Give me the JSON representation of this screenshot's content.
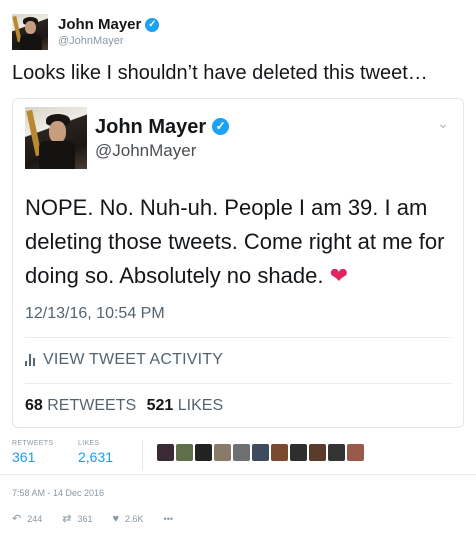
{
  "outer_tweet": {
    "display_name": "John Mayer",
    "handle": "@JohnMayer",
    "text": "Looks like I shouldn’t have deleted this tweet…"
  },
  "quoted_tweet": {
    "display_name": "John Mayer",
    "handle": "@JohnMayer",
    "text": "NOPE. No. Nuh-uh. People I am 39. I am deleting those tweets. Come right at me for doing so. Absolutely no shade.",
    "heart_glyph": "❤",
    "time": "12/13/16, 10:54 PM",
    "activity_label": "VIEW TWEET ACTIVITY",
    "retweets_count": "68",
    "retweets_label": "RETWEETS",
    "likes_count": "521",
    "likes_label": "LIKES"
  },
  "engagement": {
    "retweets_label": "RETWEETS",
    "retweets_value": "361",
    "likes_label": "LIKES",
    "likes_value": "2,631",
    "liker_colors": [
      "#3a2a35",
      "#5e6f4a",
      "#222222",
      "#8a7a6a",
      "#6d6f72",
      "#3f4a5c",
      "#7a4a30",
      "#2e2e2e",
      "#5a3a2a",
      "#333333",
      "#9a5a4a"
    ]
  },
  "timestamp": "7:58 AM - 14 Dec 2016",
  "actions": {
    "replies": "244",
    "retweets": "361",
    "likes": "2.6K",
    "more": "•••"
  },
  "colors": {
    "accent": "#1da1f2",
    "heart": "#e0245e",
    "muted": "#8899a6"
  }
}
